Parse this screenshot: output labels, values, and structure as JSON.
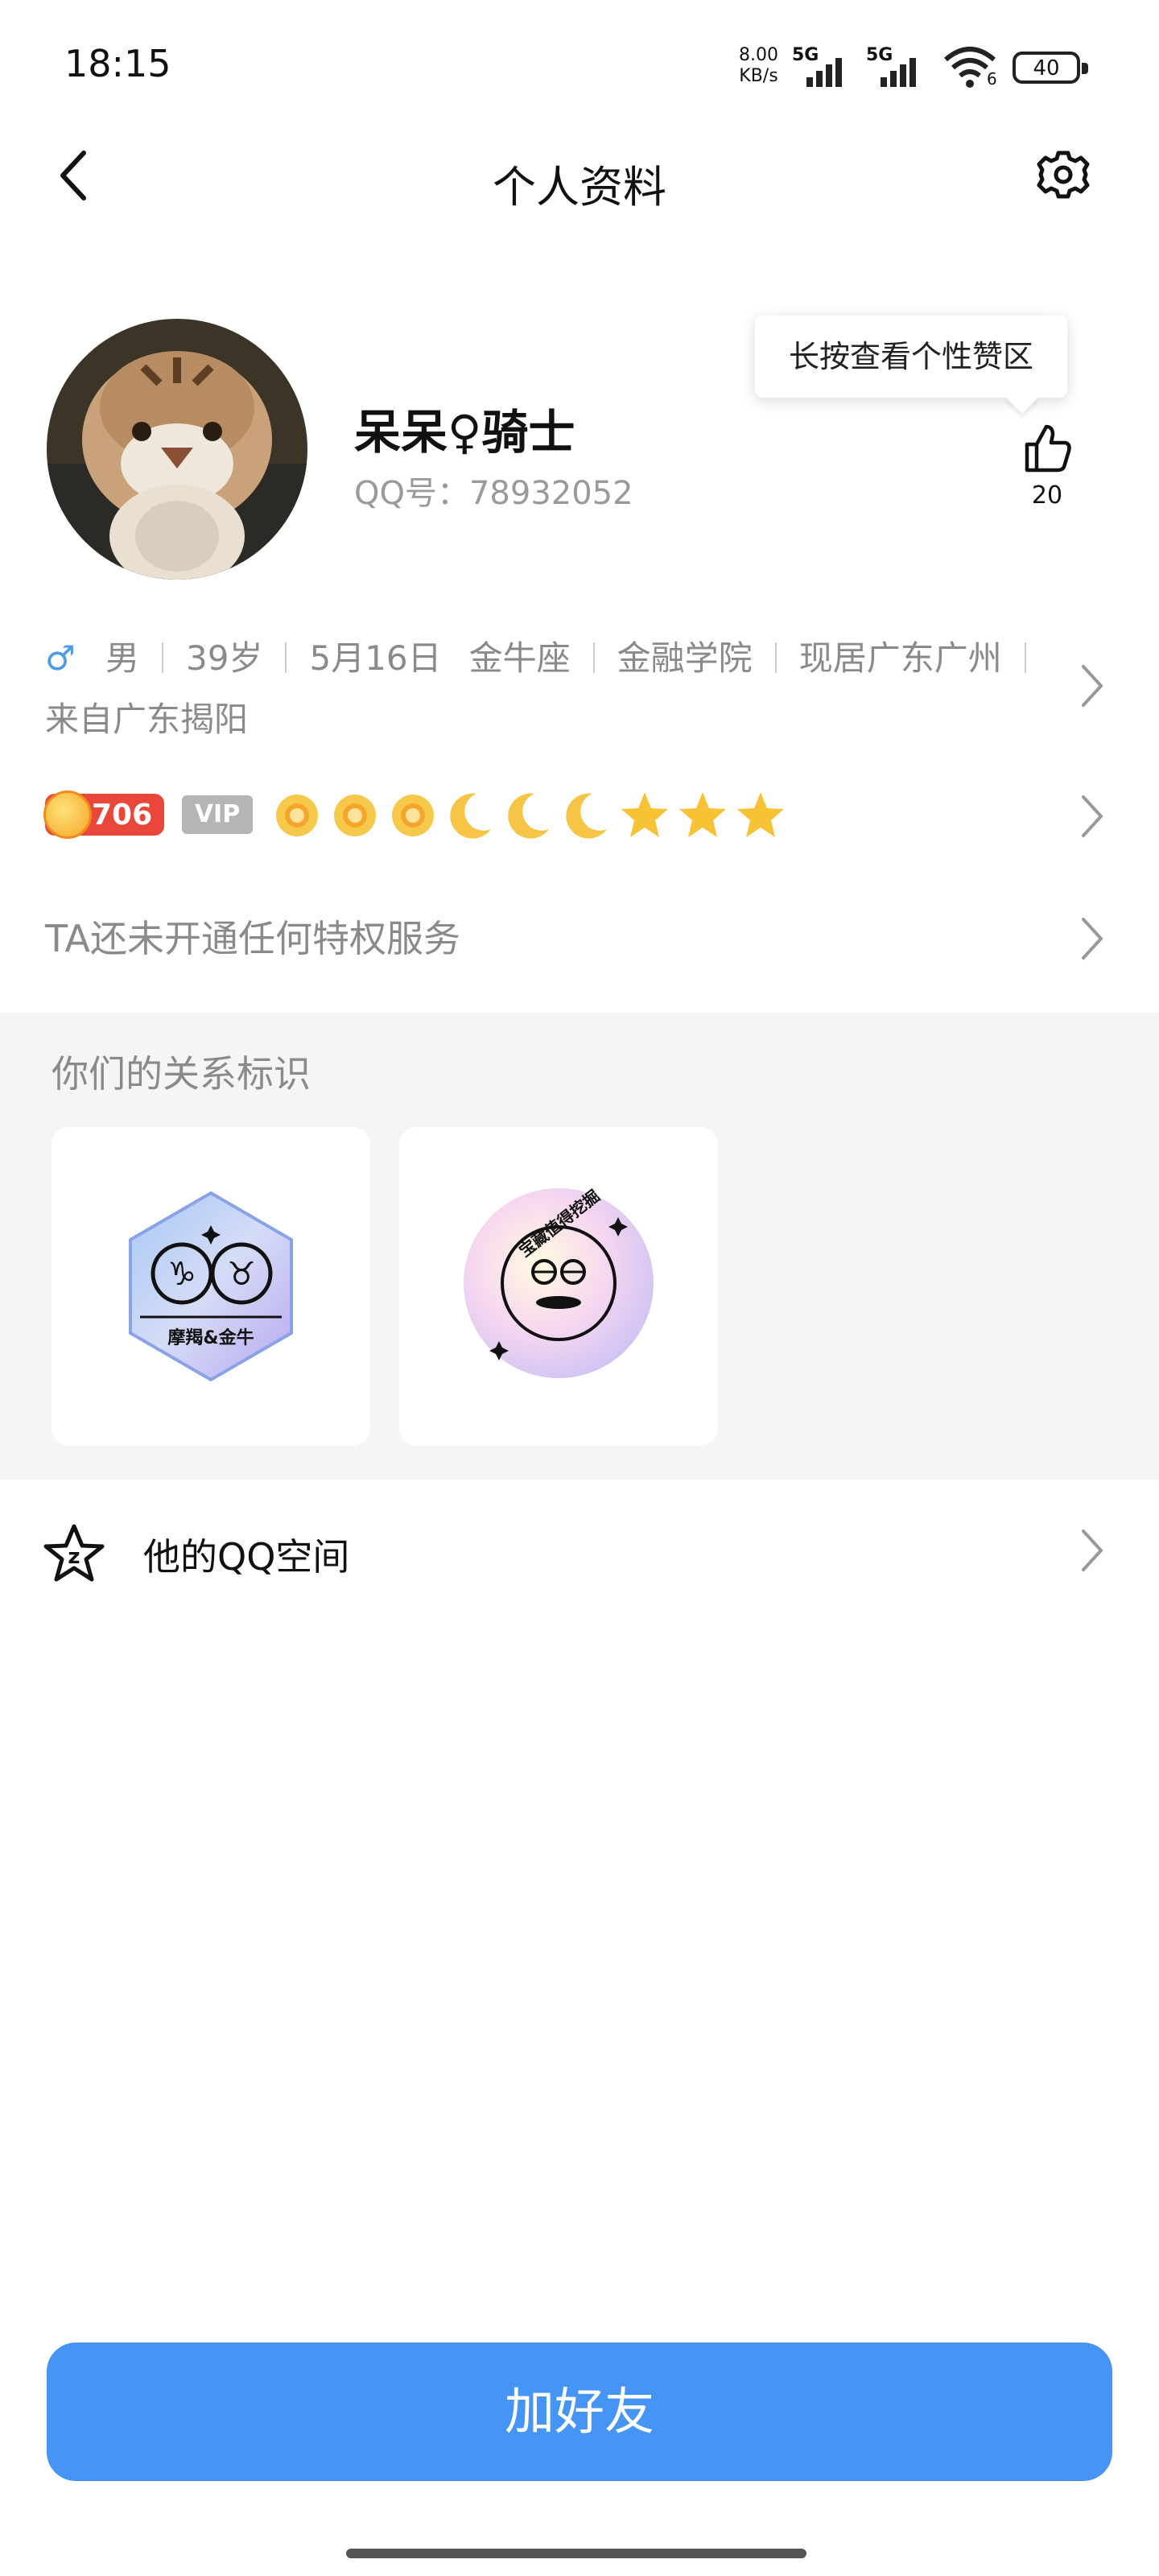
{
  "status_bar": {
    "time": "18:15",
    "speed": "8.00",
    "speed_unit": "KB/s",
    "sim1": "5G",
    "sim2": "5G",
    "wifi_level": "6",
    "battery": "40"
  },
  "nav": {
    "title": "个人资料",
    "back_icon": "chevron-left-icon",
    "settings_icon": "gear-icon"
  },
  "profile": {
    "nickname": "呆呆♀骑士",
    "qq_number": "QQ号：78932052",
    "tooltip": "长按查看个性赞区",
    "like_count": "20"
  },
  "info": {
    "gender_symbol": "♂",
    "gender": "男",
    "age": "39岁",
    "birthday": "5月16日",
    "zodiac": "金牛座",
    "school": "金融学院",
    "location": "现居广东广州",
    "hometown": "来自广东揭阳"
  },
  "levels": {
    "level_number": "706",
    "vip_label": "VIP",
    "icons": [
      "sun",
      "sun",
      "sun",
      "moon",
      "moon",
      "moon",
      "star",
      "star",
      "star"
    ]
  },
  "privilege_text": "TA还未开通任何特权服务",
  "relation": {
    "heading": "你们的关系标识",
    "card1_label": "摩羯&金牛",
    "card2_label": "宝藏值得挖掘"
  },
  "qzone": {
    "label": "他的QQ空间"
  },
  "add_friend_label": "加好友",
  "colors": {
    "accent": "#4495f5",
    "gender_blue": "#4a9be8",
    "level_red": "#e8473a",
    "vip_grey": "#b5b5b5",
    "section_bg": "#f5f5f5"
  }
}
